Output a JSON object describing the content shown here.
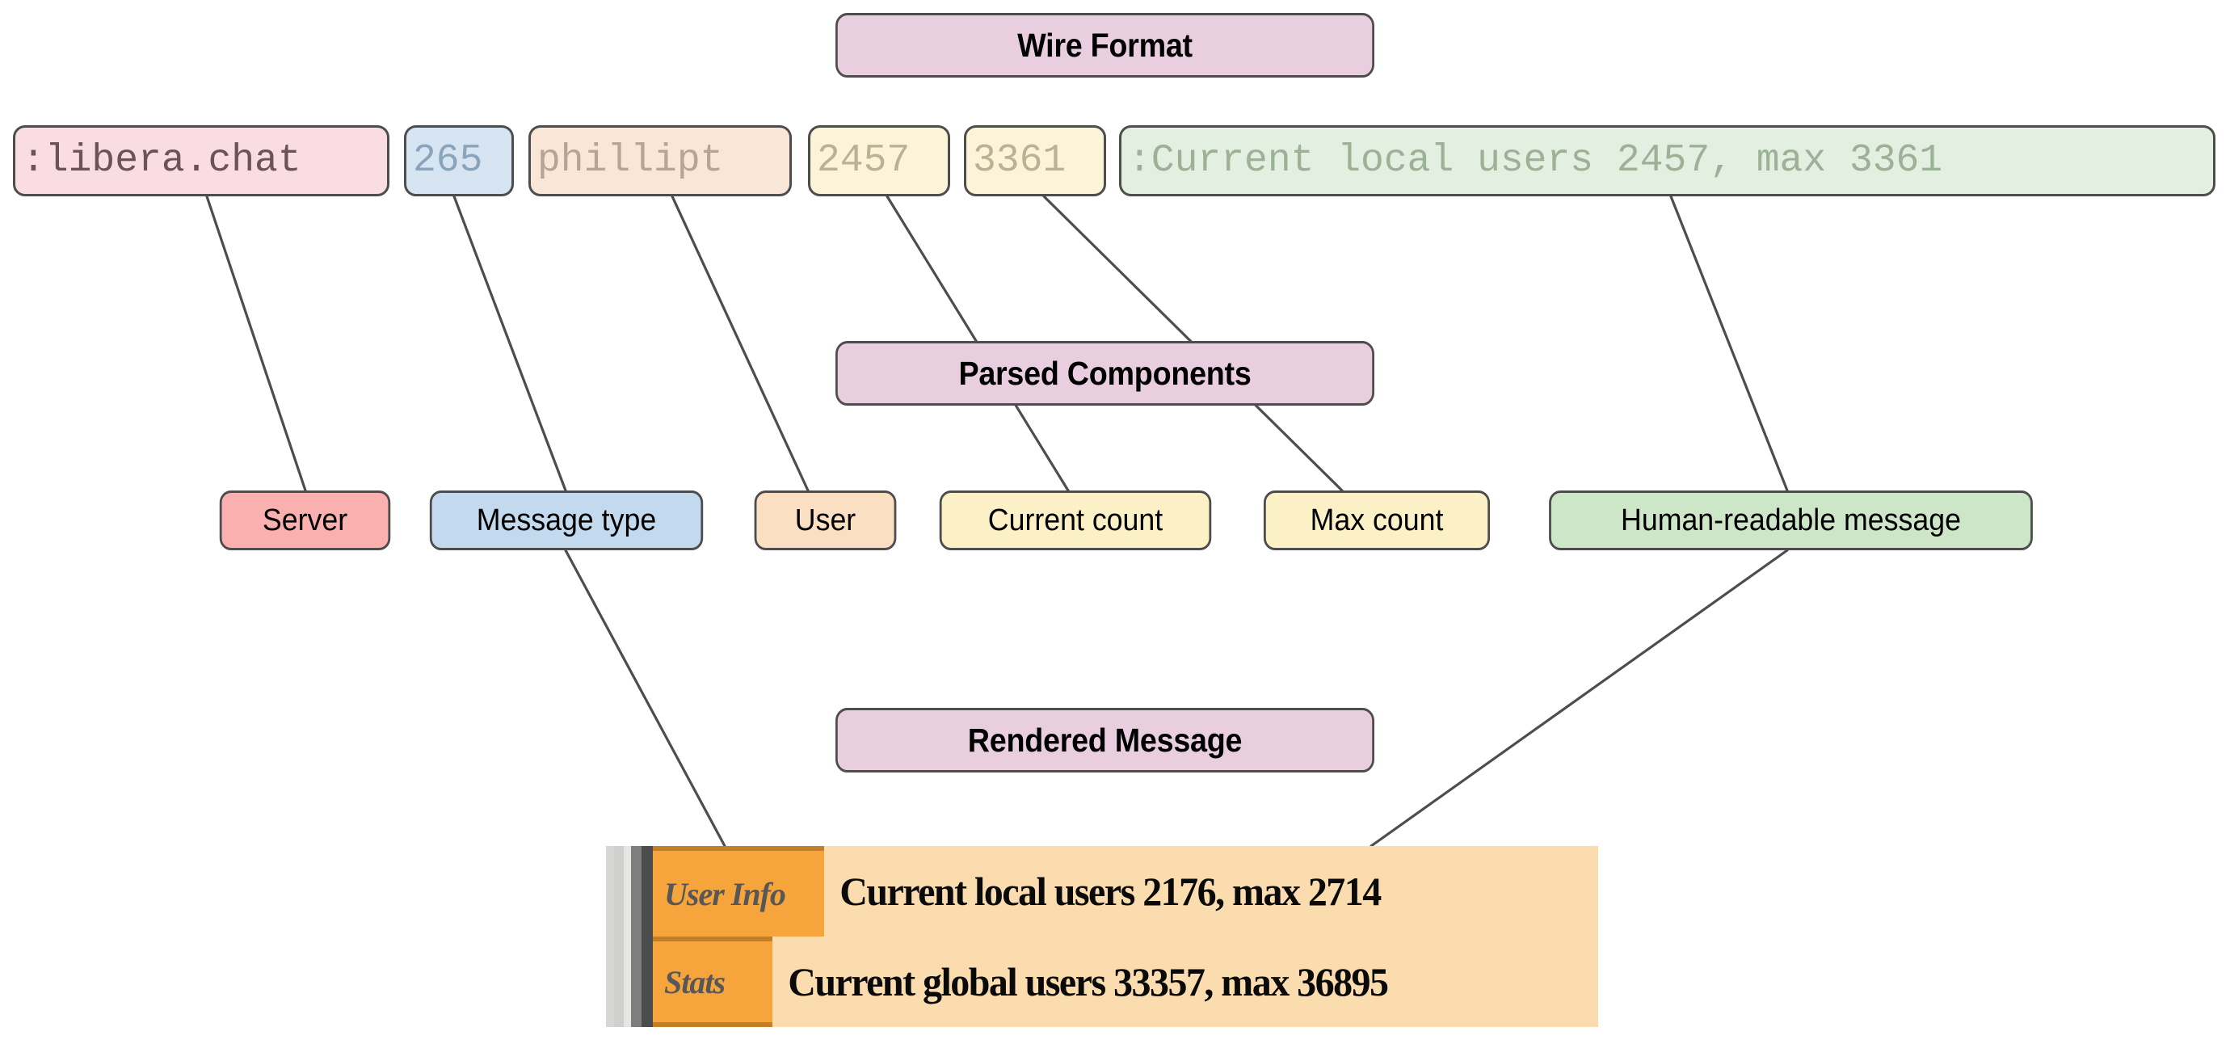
{
  "diagram": {
    "title_sections": [
      {
        "id": "wire-format",
        "label": "Wire Format"
      },
      {
        "id": "parsed-components",
        "label": "Parsed Components"
      },
      {
        "id": "rendered-message",
        "label": "Rendered Message"
      }
    ]
  },
  "wire_format": {
    "tokens": [
      {
        "id": "server",
        "text": ":libera.chat",
        "fill": "#fadde2",
        "ink": "#6b5359"
      },
      {
        "id": "numeric",
        "text": "265",
        "fill": "#d7e5f2",
        "ink": "#8aa5bb"
      },
      {
        "id": "nick",
        "text": "phillipt",
        "fill": "#fae6d7",
        "ink": "#b9a396"
      },
      {
        "id": "current",
        "text": "2457",
        "fill": "#fbf4d8",
        "ink": "#bab295"
      },
      {
        "id": "max",
        "text": "3361",
        "fill": "#fbf4d8",
        "ink": "#bab295"
      },
      {
        "id": "trailing",
        "text": ":Current local users 2457, max 3361",
        "fill": "#e3efe0",
        "ink": "#9db197"
      }
    ]
  },
  "parsed_components": {
    "items": [
      {
        "id": "server",
        "label": "Server",
        "fill": "#fbb0b0"
      },
      {
        "id": "message-type",
        "label": "Message type",
        "fill": "#c3d9ee"
      },
      {
        "id": "user",
        "label": "User",
        "fill": "#fbdfc2"
      },
      {
        "id": "current-count",
        "label": "Current count",
        "fill": "#fcf0c6"
      },
      {
        "id": "max-count",
        "label": "Max count",
        "fill": "#fcf0c6"
      },
      {
        "id": "human-readable",
        "label": "Human-readable message",
        "fill": "#cee6c8"
      }
    ]
  },
  "rendered_message": {
    "lines": [
      {
        "tag": "User Info",
        "text": "Current local users 2176, max 2714"
      },
      {
        "tag": "Stats",
        "text": "Current global users 33357, max 36895"
      }
    ],
    "background": "#fbdcaf",
    "tag_background": "#f6a43c"
  },
  "style": {
    "stroke": "#4d4d4d",
    "title_fill": "#e8cede",
    "canvas": "#ffffff"
  }
}
